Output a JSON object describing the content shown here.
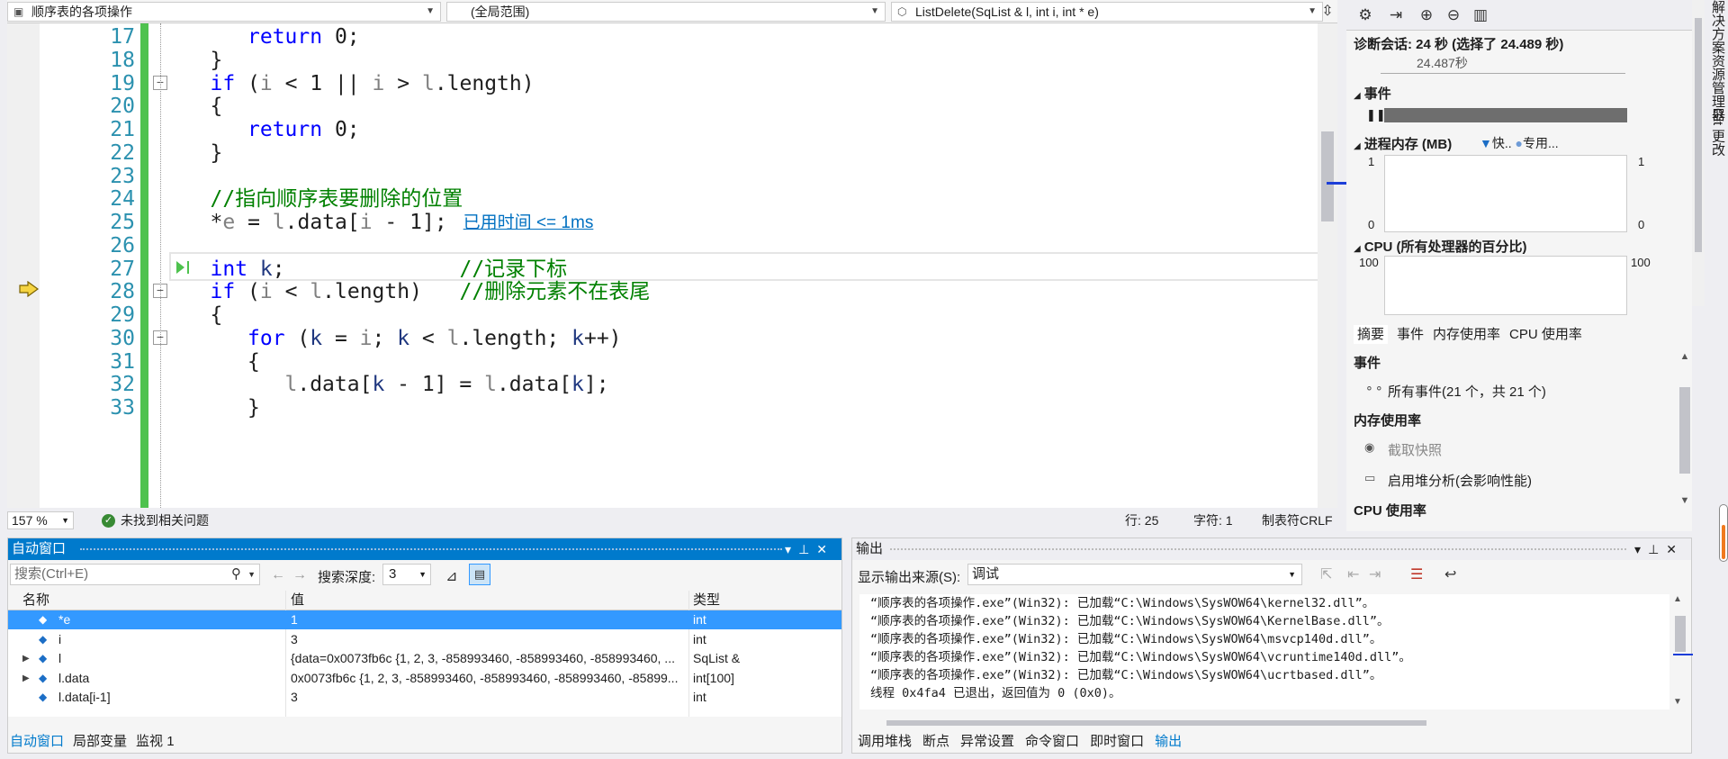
{
  "nav": {
    "project_dropdown": "顺序表的各项操作",
    "scope_dropdown": "(全局范围)",
    "function_dropdown": "ListDelete(SqList & l, int i, int * e)"
  },
  "code_lines": [
    {
      "num": "17",
      "indent": 2,
      "tokens": [
        {
          "t": "return",
          "c": "kw"
        },
        {
          "t": " 0;",
          "c": ""
        }
      ]
    },
    {
      "num": "18",
      "indent": 1,
      "tokens": [
        {
          "t": "}",
          "c": ""
        }
      ]
    },
    {
      "num": "19",
      "indent": 1,
      "fold": true,
      "tokens": [
        {
          "t": "if",
          "c": "kw"
        },
        {
          "t": " (",
          "c": ""
        },
        {
          "t": "i",
          "c": "par"
        },
        {
          "t": " < 1 || ",
          "c": ""
        },
        {
          "t": "i",
          "c": "par"
        },
        {
          "t": " > ",
          "c": ""
        },
        {
          "t": "l",
          "c": "par"
        },
        {
          "t": ".length)",
          "c": ""
        }
      ]
    },
    {
      "num": "20",
      "indent": 1,
      "tokens": [
        {
          "t": "{",
          "c": ""
        }
      ]
    },
    {
      "num": "21",
      "indent": 2,
      "tokens": [
        {
          "t": "return",
          "c": "kw"
        },
        {
          "t": " 0;",
          "c": ""
        }
      ]
    },
    {
      "num": "22",
      "indent": 1,
      "tokens": [
        {
          "t": "}",
          "c": ""
        }
      ]
    },
    {
      "num": "23",
      "indent": 0,
      "tokens": []
    },
    {
      "num": "24",
      "indent": 1,
      "tokens": [
        {
          "t": "//指向顺序表要删除的位置",
          "c": "cm"
        }
      ]
    },
    {
      "num": "25",
      "indent": 1,
      "current": true,
      "tokens": [
        {
          "t": "*",
          "c": ""
        },
        {
          "t": "e",
          "c": "par"
        },
        {
          "t": " = ",
          "c": ""
        },
        {
          "t": "l",
          "c": "par"
        },
        {
          "t": ".data[",
          "c": ""
        },
        {
          "t": "i",
          "c": "par"
        },
        {
          "t": " - 1];",
          "c": ""
        }
      ]
    },
    {
      "num": "26",
      "indent": 0,
      "tokens": []
    },
    {
      "num": "27",
      "indent": 1,
      "tokens": [
        {
          "t": "int",
          "c": "kw"
        },
        {
          "t": " ",
          "c": ""
        },
        {
          "t": "k",
          "c": "var"
        },
        {
          "t": ";              ",
          "c": ""
        },
        {
          "t": "//记录下标",
          "c": "cm"
        }
      ]
    },
    {
      "num": "28",
      "indent": 1,
      "fold": true,
      "tokens": [
        {
          "t": "if",
          "c": "kw"
        },
        {
          "t": " (",
          "c": ""
        },
        {
          "t": "i",
          "c": "par"
        },
        {
          "t": " < ",
          "c": ""
        },
        {
          "t": "l",
          "c": "par"
        },
        {
          "t": ".length)   ",
          "c": ""
        },
        {
          "t": "//删除元素不在表尾",
          "c": "cm"
        }
      ]
    },
    {
      "num": "29",
      "indent": 1,
      "tokens": [
        {
          "t": "{",
          "c": ""
        }
      ]
    },
    {
      "num": "30",
      "indent": 2,
      "fold": true,
      "tokens": [
        {
          "t": "for",
          "c": "kw"
        },
        {
          "t": " (",
          "c": ""
        },
        {
          "t": "k",
          "c": "var"
        },
        {
          "t": " = ",
          "c": ""
        },
        {
          "t": "i",
          "c": "par"
        },
        {
          "t": "; ",
          "c": ""
        },
        {
          "t": "k",
          "c": "var"
        },
        {
          "t": " < ",
          "c": ""
        },
        {
          "t": "l",
          "c": "par"
        },
        {
          "t": ".length; ",
          "c": ""
        },
        {
          "t": "k",
          "c": "var"
        },
        {
          "t": "++)",
          "c": ""
        }
      ]
    },
    {
      "num": "31",
      "indent": 2,
      "tokens": [
        {
          "t": "{",
          "c": ""
        }
      ]
    },
    {
      "num": "32",
      "indent": 3,
      "tokens": [
        {
          "t": "l",
          "c": "par"
        },
        {
          "t": ".data[",
          "c": ""
        },
        {
          "t": "k",
          "c": "var"
        },
        {
          "t": " - 1] = ",
          "c": ""
        },
        {
          "t": "l",
          "c": "par"
        },
        {
          "t": ".data[",
          "c": ""
        },
        {
          "t": "k",
          "c": "var"
        },
        {
          "t": "];",
          "c": ""
        }
      ]
    },
    {
      "num": "33",
      "indent": 2,
      "tokens": [
        {
          "t": "}",
          "c": ""
        }
      ]
    }
  ],
  "perf_tip": "已用时间 <= 1ms",
  "status": {
    "zoom": "157 %",
    "issues": "未找到相关问题",
    "line": "行: 25",
    "char": "字符: 1",
    "tab": "制表符",
    "eol": "CRLF"
  },
  "diag": {
    "session": "诊断会话: 24 秒 (选择了 24.489 秒)",
    "timeline_label": "24.487秒",
    "events_title": "事件",
    "memory_title": "进程内存 (MB)",
    "memory_legend_1": "快..",
    "memory_legend_2": "专用...",
    "mem_axis_top_left": "1",
    "mem_axis_bottom_left": "0",
    "mem_axis_top_right": "1",
    "mem_axis_bottom_right": "0",
    "cpu_title": "CPU (所有处理器的百分比)",
    "cpu_axis_left": "100",
    "cpu_axis_right": "100",
    "tabs": [
      "摘要",
      "事件",
      "内存使用率",
      "CPU 使用率"
    ],
    "events_section": "事件",
    "all_events": "所有事件(21 个，共 21 个)",
    "memory_section": "内存使用率",
    "take_snapshot": "截取快照",
    "heap_analysis": "启用堆分析(会影响性能)",
    "cpu_section": "CPU 使用率"
  },
  "vtabs": {
    "solution_explorer": "解决方案资源管理器",
    "git_changes": "Git 更改"
  },
  "autos": {
    "title": "自动窗口",
    "search_placeholder": "搜索(Ctrl+E)",
    "depth_label": "搜索深度:",
    "depth_value": "3",
    "col_name": "名称",
    "col_value": "值",
    "col_type": "类型",
    "rows": [
      {
        "name": "*e",
        "value": "1",
        "type": "int",
        "expandable": false,
        "selected": true
      },
      {
        "name": "i",
        "value": "3",
        "type": "int",
        "expandable": false,
        "selected": false
      },
      {
        "name": "l",
        "value": "{data=0x0073fb6c {1, 2, 3, -858993460, -858993460, -858993460, ...",
        "type": "SqList &",
        "expandable": true,
        "selected": false
      },
      {
        "name": "l.data",
        "value": "0x0073fb6c {1, 2, 3, -858993460, -858993460, -858993460, -85899...",
        "type": "int[100]",
        "expandable": true,
        "selected": false
      },
      {
        "name": "l.data[i-1]",
        "value": "3",
        "type": "int",
        "expandable": false,
        "selected": false
      }
    ],
    "tabs": [
      "自动窗口",
      "局部变量",
      "监视 1"
    ]
  },
  "output": {
    "title": "输出",
    "source_label": "显示输出来源(S):",
    "source_value": "调试",
    "text": "“顺序表的各项操作.exe”(Win32): 已加载“C:\\Windows\\SysWOW64\\kernel32.dll”。\n“顺序表的各项操作.exe”(Win32): 已加载“C:\\Windows\\SysWOW64\\KernelBase.dll”。\n“顺序表的各项操作.exe”(Win32): 已加载“C:\\Windows\\SysWOW64\\msvcp140d.dll”。\n“顺序表的各项操作.exe”(Win32): 已加载“C:\\Windows\\SysWOW64\\vcruntime140d.dll”。\n“顺序表的各项操作.exe”(Win32): 已加载“C:\\Windows\\SysWOW64\\ucrtbased.dll”。\n线程 0x4fa4 已退出，返回值为 0 (0x0)。",
    "tabs": [
      "调用堆栈",
      "断点",
      "异常设置",
      "命令窗口",
      "即时窗口",
      "输出"
    ]
  }
}
